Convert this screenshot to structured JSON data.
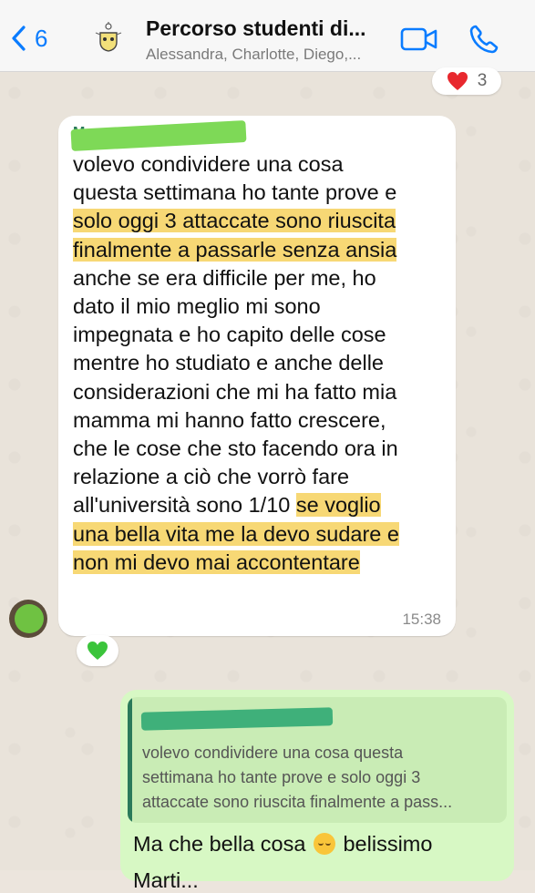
{
  "header": {
    "back_count": "6",
    "title": "Percorso studenti di...",
    "subtitle": "Alessandra, Charlotte, Diego,..."
  },
  "top_reaction": {
    "emoji": "heart-icon",
    "count": "3"
  },
  "incoming": {
    "sender_initial": "M",
    "lines": [
      {
        "text": "volevo condividere una cosa",
        "highlight": false
      },
      {
        "text": "questa settimana ho tante prove e",
        "highlight": false
      },
      {
        "text": "solo oggi 3 attaccate sono riuscita",
        "highlight": true
      },
      {
        "text": "finalmente a passarle senza ansia",
        "highlight": true
      },
      {
        "text": "anche se era difficile per me, ho",
        "highlight": false
      },
      {
        "text": "dato il mio meglio mi sono",
        "highlight": false
      },
      {
        "text": "impegnata e ho capito delle cose",
        "highlight": false
      },
      {
        "text": "mentre ho studiato e anche delle",
        "highlight": false
      },
      {
        "text": "considerazioni che mi ha fatto mia",
        "highlight": false
      },
      {
        "text": "mamma mi hanno fatto crescere,",
        "highlight": false
      },
      {
        "text": "che le cose che sto facendo ora in",
        "highlight": false
      },
      {
        "text": "relazione a ciò che vorrò fare",
        "highlight": false
      }
    ],
    "line13_plain": "all'università sono 1/10 ",
    "line13_highlight": "se voglio",
    "line14": "una bella vita me la devo sudare e",
    "line15": "non mi devo mai accontentare",
    "time": "15:38",
    "reaction": "green-heart-icon"
  },
  "outgoing": {
    "quote_lines": [
      "volevo condividere una cosa questa",
      "settimana ho tante prove e solo oggi 3",
      "attaccate sono riuscita finalmente a pass..."
    ],
    "reply_before_emoji": "Ma che bella cosa ",
    "reply_after_emoji": " belissimo",
    "reply_line2": "Marti..."
  },
  "colors": {
    "accent": "#0a7cff",
    "incoming_bubble": "#ffffff",
    "outgoing_bubble": "#d7f8c4",
    "highlight": "#f7d875",
    "censor": "#7ed957"
  }
}
